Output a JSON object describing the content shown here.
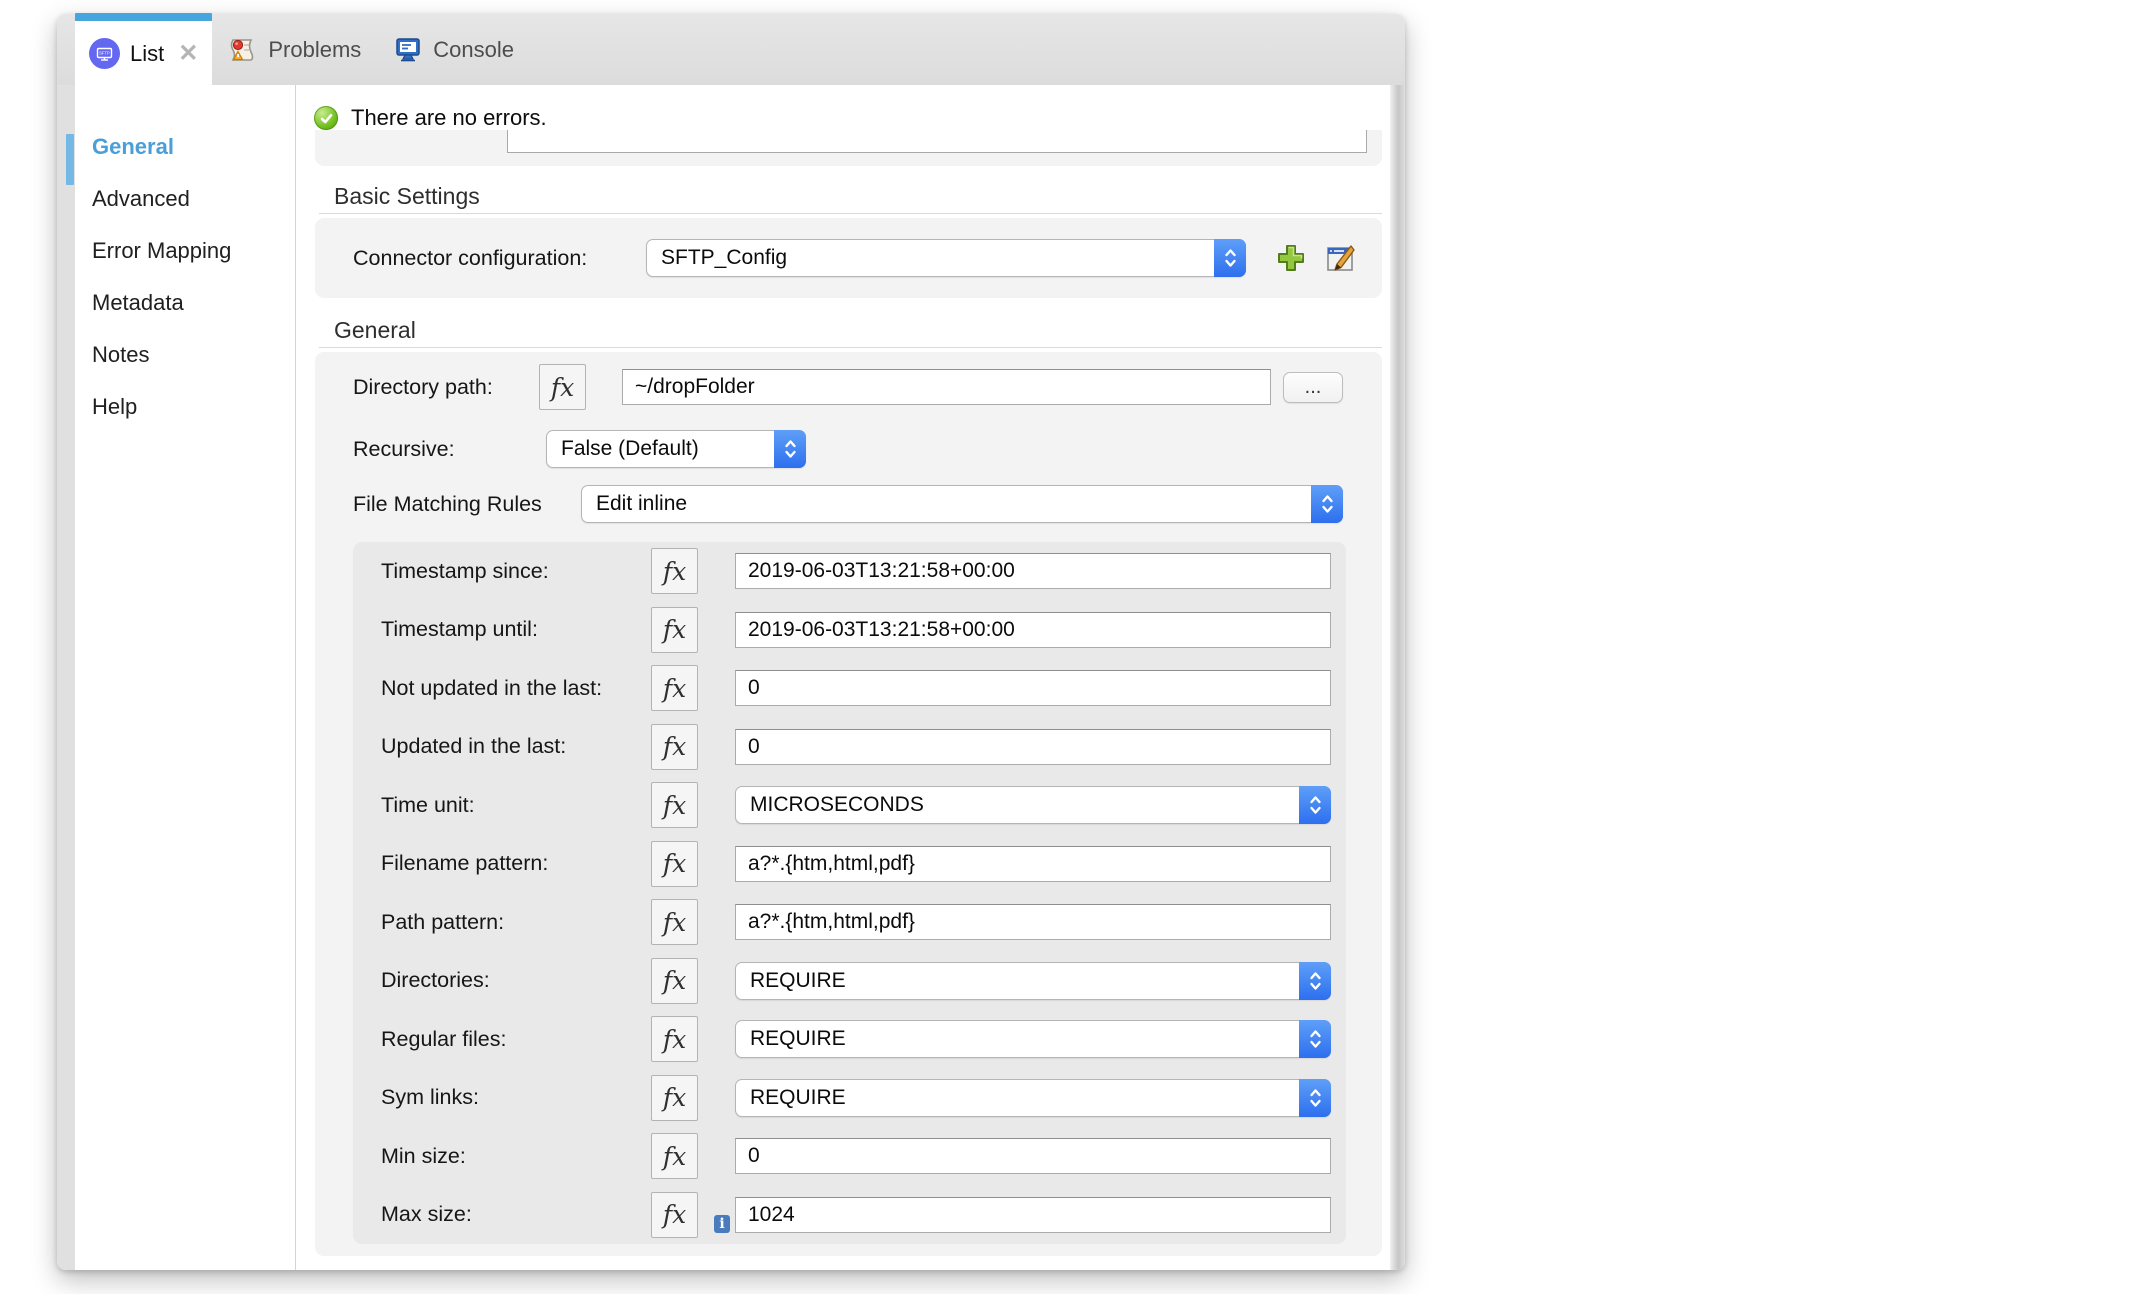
{
  "tabs": [
    {
      "label": "List",
      "active": true,
      "closable": true,
      "icon": "sftp-operation-icon"
    },
    {
      "label": "Problems",
      "active": false,
      "icon": "problems-icon"
    },
    {
      "label": "Console",
      "active": false,
      "icon": "console-icon"
    }
  ],
  "sidebar": {
    "items": [
      {
        "label": "General",
        "active": true
      },
      {
        "label": "Advanced",
        "active": false
      },
      {
        "label": "Error Mapping",
        "active": false
      },
      {
        "label": "Metadata",
        "active": false
      },
      {
        "label": "Notes",
        "active": false
      },
      {
        "label": "Help",
        "active": false
      }
    ]
  },
  "status": {
    "message": "There are no errors."
  },
  "fx_label": "fx",
  "sections": {
    "basic": {
      "title": "Basic Settings",
      "connector": {
        "label": "Connector configuration:",
        "value": "SFTP_Config"
      }
    },
    "general": {
      "title": "General",
      "directory_path": {
        "label": "Directory path:",
        "value": "~/dropFolder",
        "browse_label": "..."
      },
      "recursive": {
        "label": "Recursive:",
        "value": "False (Default)"
      },
      "file_matching": {
        "label": "File Matching Rules",
        "value": "Edit inline"
      },
      "rules": [
        {
          "label": "Timestamp since:",
          "control": "input",
          "value": "2019-06-03T13:21:58+00:00"
        },
        {
          "label": "Timestamp until:",
          "control": "input",
          "value": "2019-06-03T13:21:58+00:00"
        },
        {
          "label": "Not updated in the last:",
          "control": "input",
          "value": "0"
        },
        {
          "label": "Updated in the last:",
          "control": "input",
          "value": "0"
        },
        {
          "label": "Time unit:",
          "control": "select",
          "value": "MICROSECONDS"
        },
        {
          "label": "Filename pattern:",
          "control": "input",
          "value": "a?*.{htm,html,pdf}"
        },
        {
          "label": "Path pattern:",
          "control": "input",
          "value": "a?*.{htm,html,pdf}"
        },
        {
          "label": "Directories:",
          "control": "select",
          "value": "REQUIRE"
        },
        {
          "label": "Regular files:",
          "control": "select",
          "value": "REQUIRE"
        },
        {
          "label": "Sym links:",
          "control": "select",
          "value": "REQUIRE"
        },
        {
          "label": "Min size:",
          "control": "input",
          "value": "0"
        },
        {
          "label": "Max size:",
          "control": "input",
          "value": "1024",
          "info": true
        }
      ]
    }
  },
  "colors": {
    "tab_accent": "#47a5df",
    "sidebar_active": "#4a9fd8",
    "select_blue": "#2d6fee",
    "success_green": "#6fbe1d",
    "panel_gray": "#f3f3f3",
    "inner_panel_gray": "#e9e9e9",
    "list_icon_purple": "#6467ef"
  }
}
